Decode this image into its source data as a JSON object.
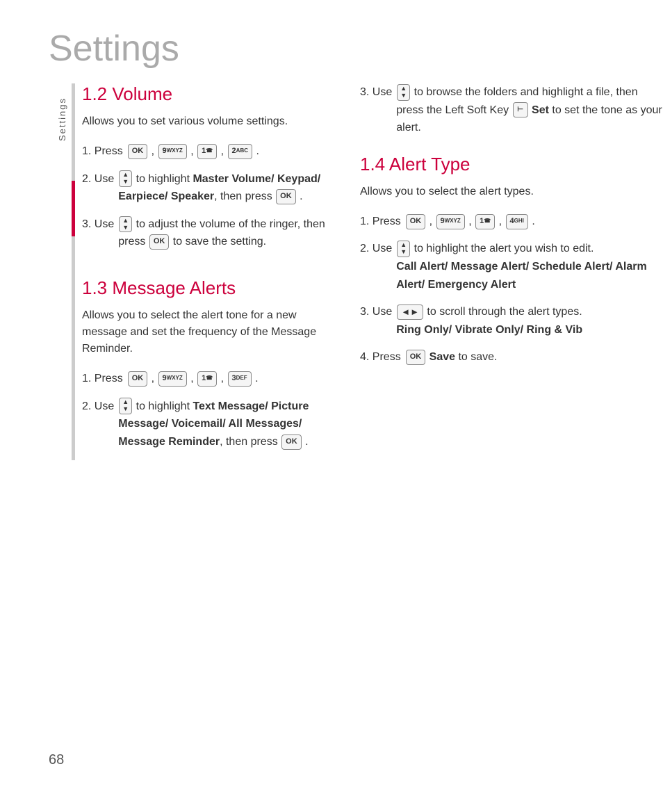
{
  "page": {
    "title": "Settings",
    "page_number": "68"
  },
  "sidebar": {
    "label": "Settings"
  },
  "sections": {
    "volume": {
      "title": "1.2 Volume",
      "description": "Allows you to set various volume settings.",
      "steps": [
        {
          "num": "1.",
          "text": "Press"
        },
        {
          "num": "2.",
          "text_pre": "Use",
          "text_bold": "Master Volume/ Keypad/ Earpiece/ Speaker",
          "text_post": ", then press"
        },
        {
          "num": "3.",
          "text_pre": "Use",
          "text_middle": "to adjust the volume of the ringer, then press",
          "text_post": "to save the setting."
        }
      ]
    },
    "message_alerts": {
      "title": "1.3 Message Alerts",
      "description": "Allows you to select the alert tone for a new message and set the frequency of the Message Reminder.",
      "steps": [
        {
          "num": "1.",
          "text": "Press"
        },
        {
          "num": "2.",
          "text_pre": "Use",
          "text_bold": "Text Message/ Picture Message/ Voicemail/ All Messages/ Message Reminder",
          "text_post": ", then press"
        }
      ]
    },
    "right_volume_step3": {
      "text_pre": "Use",
      "text_middle": "to browse the folders and highlight a file, then press the Left Soft Key",
      "text_bold_key": "Set",
      "text_post": "to set the tone as your alert."
    },
    "alert_type": {
      "title": "1.4 Alert Type",
      "description": "Allows you to select the alert types.",
      "steps": [
        {
          "num": "1.",
          "text": "Press"
        },
        {
          "num": "2.",
          "text_pre": "Use",
          "text_middle": "to highlight the alert you wish to edit.",
          "text_bold": "Call Alert/ Message Alert/ Schedule Alert/ Alarm Alert/ Emergency Alert"
        },
        {
          "num": "3.",
          "text_pre": "Use",
          "text_middle": "to scroll through the alert types.",
          "text_bold": "Ring Only/ Vibrate Only/ Ring & Vib"
        },
        {
          "num": "4.",
          "text_pre": "Press",
          "text_bold": "Save",
          "text_post": "to save."
        }
      ]
    }
  }
}
